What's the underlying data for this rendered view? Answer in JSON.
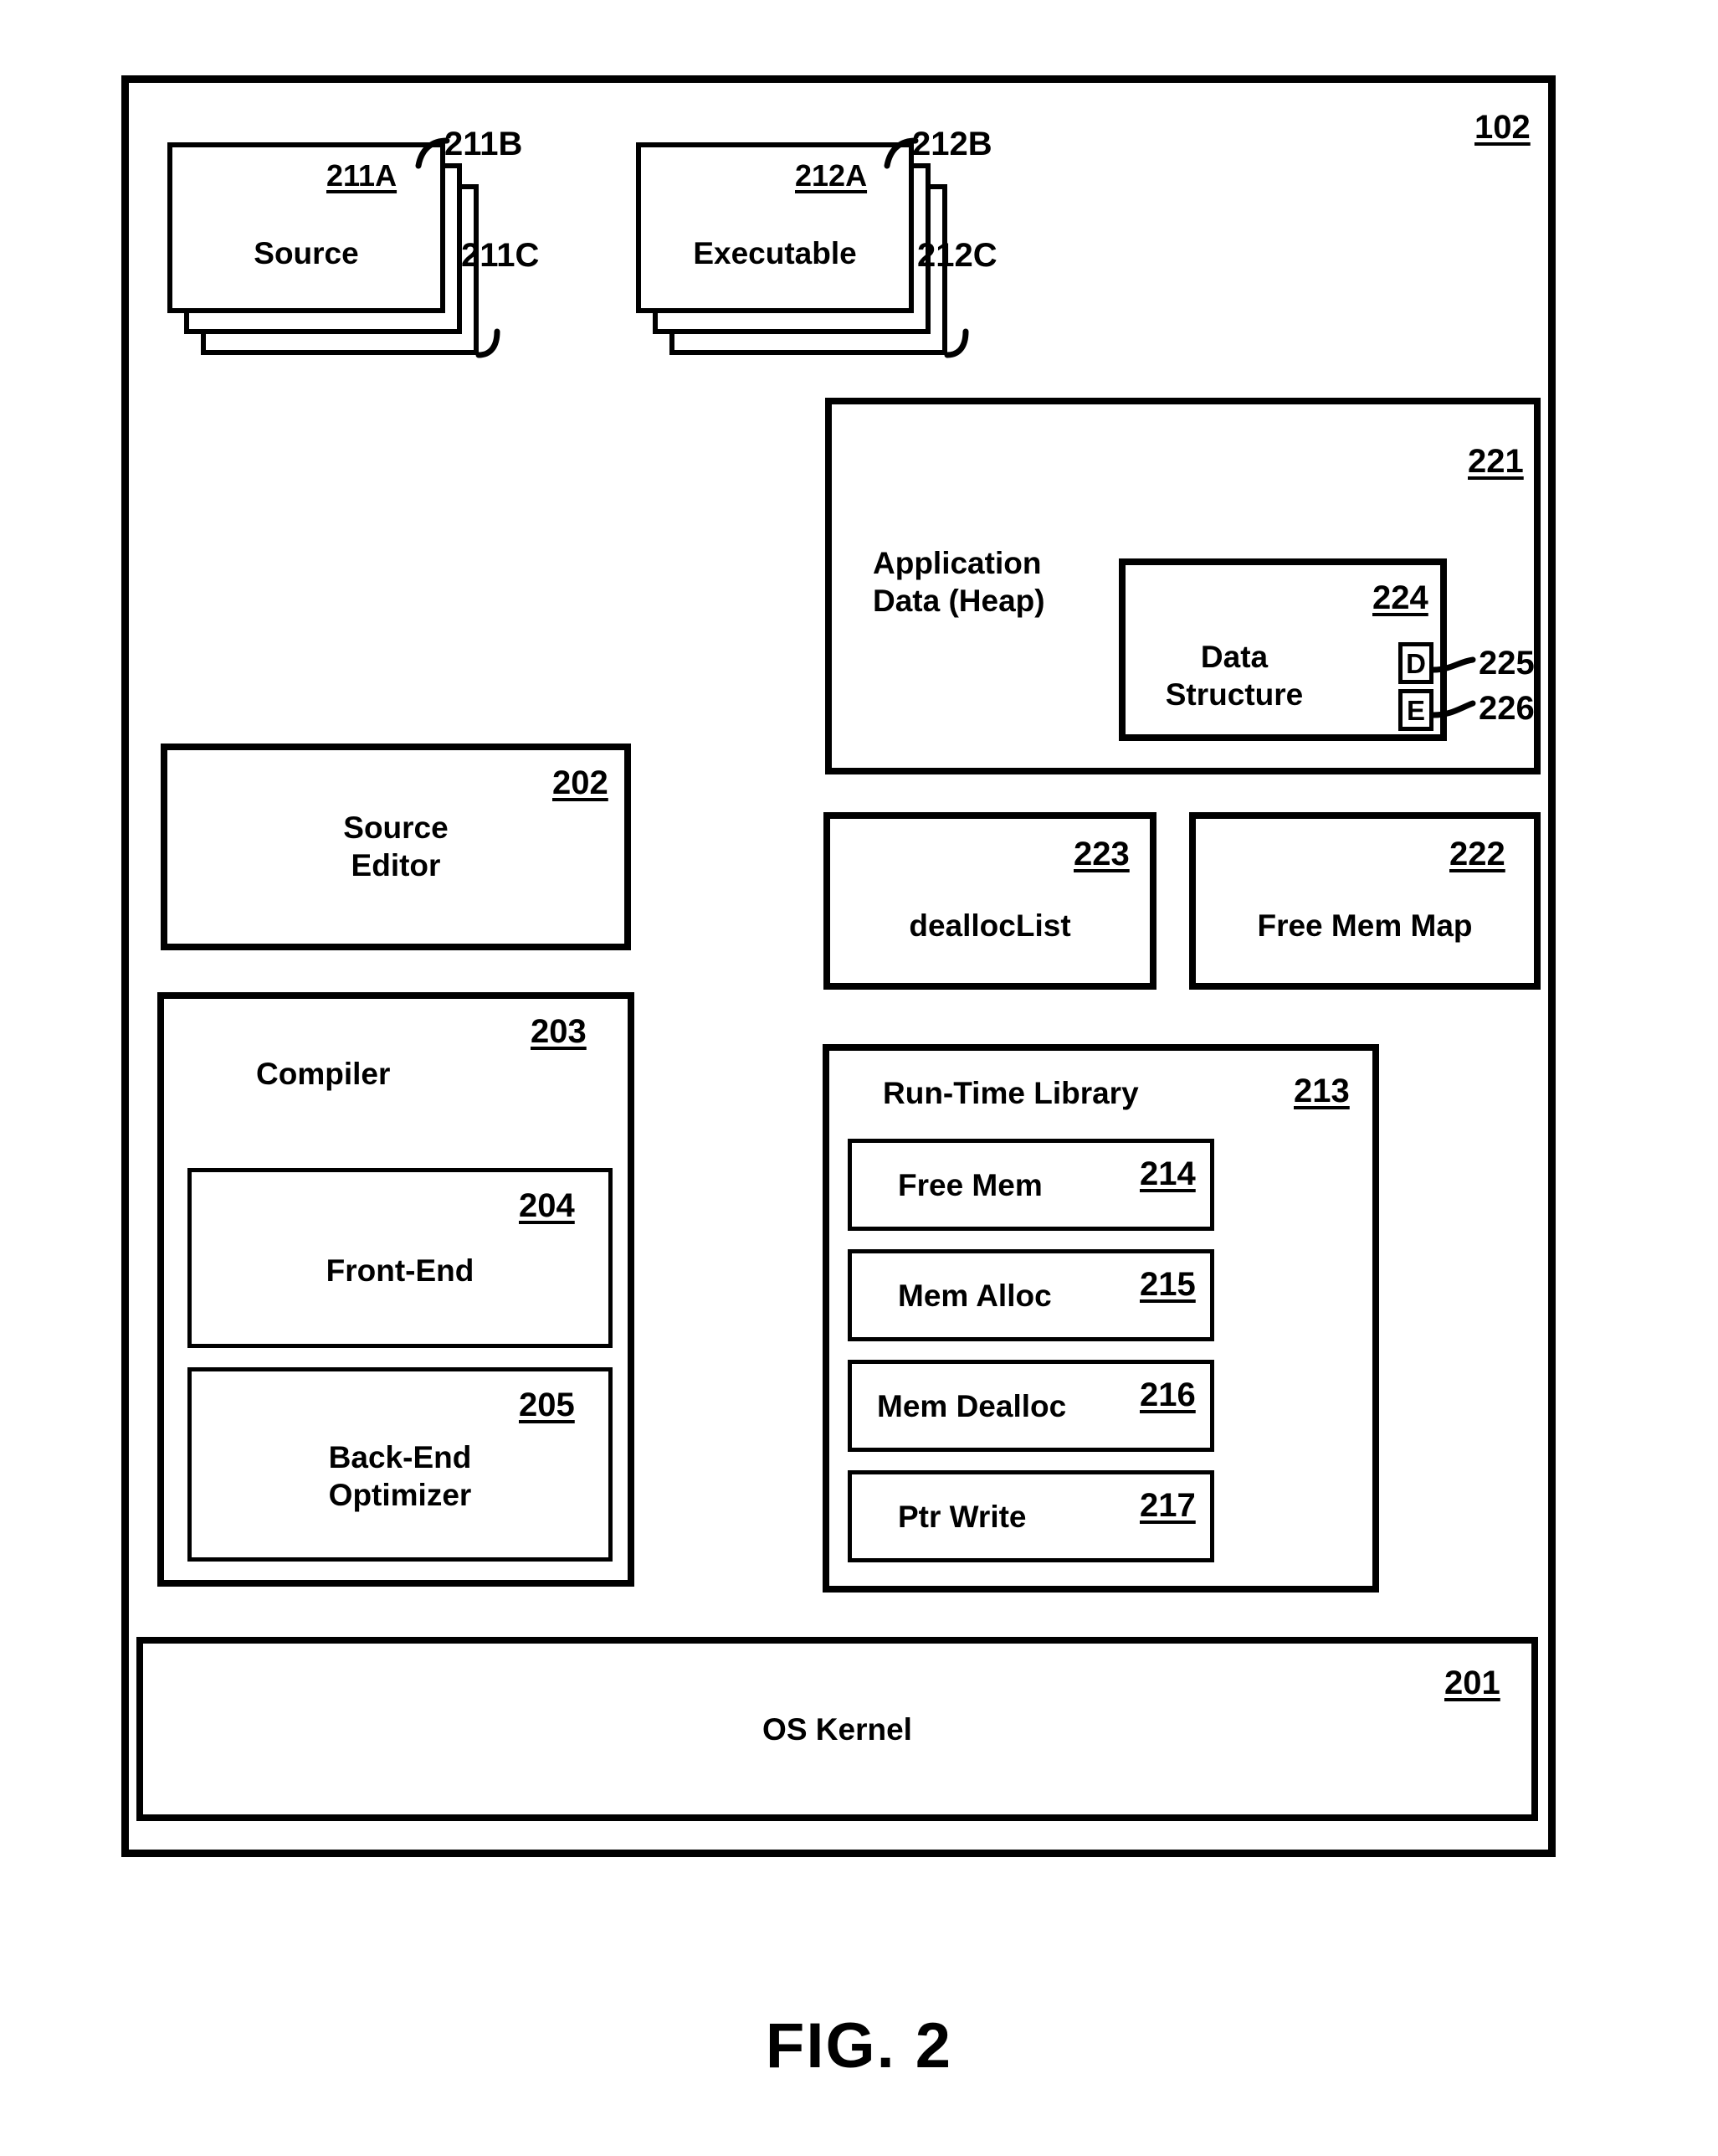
{
  "figure": {
    "caption": "FIG. 2"
  },
  "system": {
    "ref": "102"
  },
  "source_stack": {
    "label": "Source",
    "ref_front": "211A",
    "ref_middle": "211B",
    "ref_back": "211C"
  },
  "executable_stack": {
    "label": "Executable",
    "ref_front": "212A",
    "ref_middle": "212B",
    "ref_back": "212C"
  },
  "application_data": {
    "label": "Application\nData (Heap)",
    "ref": "221",
    "data_structure": {
      "label": "Data\nStructure",
      "ref": "224",
      "tags": [
        {
          "letter": "D",
          "ref": "225"
        },
        {
          "letter": "E",
          "ref": "226"
        }
      ]
    }
  },
  "source_editor": {
    "label": "Source\nEditor",
    "ref": "202"
  },
  "compiler": {
    "label": "Compiler",
    "ref": "203",
    "front_end": {
      "label": "Front-End",
      "ref": "204"
    },
    "back_end": {
      "label": "Back-End\nOptimizer",
      "ref": "205"
    }
  },
  "dealloc_list": {
    "label": "deallocList",
    "ref": "223"
  },
  "free_mem_map": {
    "label": "Free Mem Map",
    "ref": "222"
  },
  "runtime_library": {
    "label": "Run-Time Library",
    "ref": "213",
    "functions": [
      {
        "label": "Free Mem",
        "ref": "214"
      },
      {
        "label": "Mem Alloc",
        "ref": "215"
      },
      {
        "label": "Mem Dealloc",
        "ref": "216"
      },
      {
        "label": "Ptr Write",
        "ref": "217"
      }
    ]
  },
  "os_kernel": {
    "label": "OS Kernel",
    "ref": "201"
  },
  "colors": {
    "ink": "#000000",
    "paper": "#ffffff"
  }
}
